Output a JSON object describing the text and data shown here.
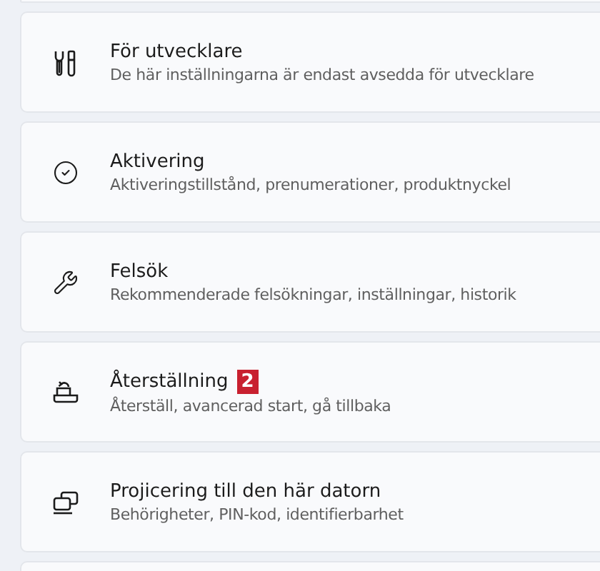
{
  "items": [
    {
      "kind": "tools",
      "title": "För utvecklare",
      "subtitle": "De här inställningarna är endast avsedda för utvecklare"
    },
    {
      "kind": "check",
      "title": "Aktivering",
      "subtitle": "Aktiveringstillstånd, prenumerationer, produktnyckel"
    },
    {
      "kind": "wrench",
      "title": "Felsök",
      "subtitle": "Rekommenderade felsökningar, inställningar, historik"
    },
    {
      "kind": "restore",
      "title": "Återställning",
      "badge": "2",
      "subtitle": "Återställ, avancerad start, gå tillbaka"
    },
    {
      "kind": "project",
      "title": "Projicering till den här datorn",
      "subtitle": "Behörigheter, PIN-kod, identifierbarhet"
    }
  ]
}
